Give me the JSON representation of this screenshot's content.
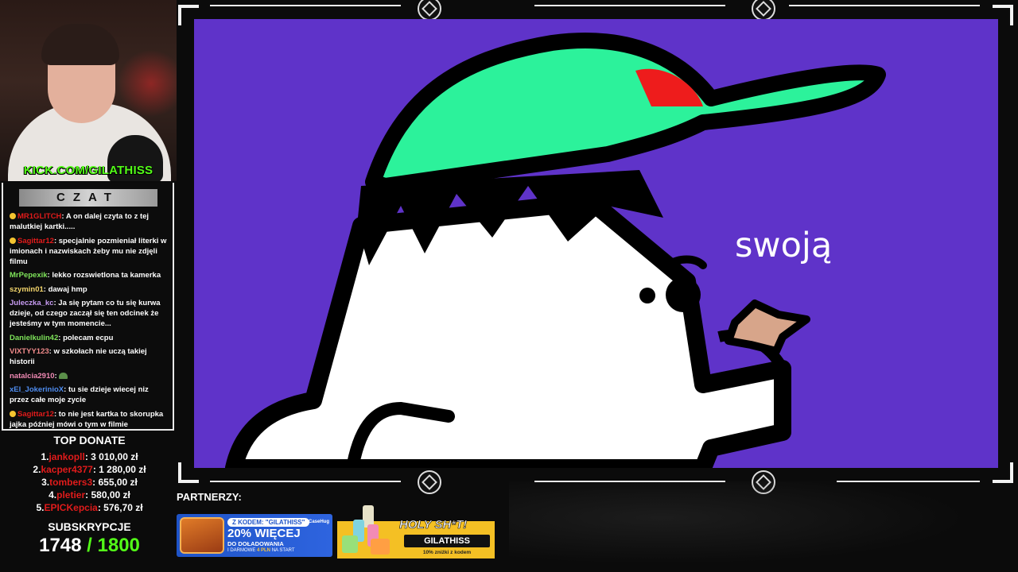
{
  "webcam": {
    "channel_url": "KICK.COM/GILATHISS"
  },
  "chat": {
    "title": "CZAT",
    "messages": [
      {
        "user": "MR1GLITCH",
        "color": "#e01b1b",
        "badge": true,
        "text": "A on dalej czyta to z tej malutkiej kartki....."
      },
      {
        "user": "Sagittar12",
        "color": "#e01b1b",
        "badge": true,
        "text": "specjalnie pozmieniał literki w imionach i nazwiskach żeby mu nie zdjęli filmu"
      },
      {
        "user": "MrPepexik",
        "color": "#7ee35a",
        "badge": false,
        "text": "lekko rozswietlona ta kamerka"
      },
      {
        "user": "szymin01",
        "color": "#f2d46b",
        "badge": false,
        "text": "dawaj hmp"
      },
      {
        "user": "Juleczka_kc",
        "color": "#c79bf2",
        "badge": false,
        "text": "Ja się pytam co tu się kurwa dzieje, od czego zaczął się ten odcinek że jesteśmy w tym momencie..."
      },
      {
        "user": "Danielkulin42",
        "color": "#7ee35a",
        "badge": false,
        "text": "polecam ecpu"
      },
      {
        "user": "VIXTYY123",
        "color": "#f08a8a",
        "badge": false,
        "text": "w szkołach nie uczą takiej historii"
      },
      {
        "user": "natalcia2910",
        "color": "#f08ab4",
        "badge": false,
        "text": "",
        "emote": true
      },
      {
        "user": "xEl_JokerinioX",
        "color": "#4f8df0",
        "badge": false,
        "text": "tu sie dzieje wiecej niz przez całe moje zycie"
      },
      {
        "user": "Sagittar12",
        "color": "#e01b1b",
        "badge": true,
        "text": "to nie jest kartka to skorupka jajka później mówi o tym w filmie"
      }
    ]
  },
  "top_donate": {
    "title": "TOP DONATE",
    "entries": [
      {
        "rank": "1.",
        "name": "jankopll",
        "amount": "3 010,00 zł"
      },
      {
        "rank": "2.",
        "name": "kacper4377",
        "amount": "1 280,00 zł"
      },
      {
        "rank": "3.",
        "name": "tombers3",
        "amount": "655,00 zł"
      },
      {
        "rank": "4.",
        "name": "pletier",
        "amount": "580,00 zł"
      },
      {
        "rank": "5.",
        "name": "EPICKepcia",
        "amount": "576,70 zł"
      }
    ]
  },
  "subs": {
    "title": "SUBSKRYPCJE",
    "current": "1748",
    "goal": "/ 1800"
  },
  "video": {
    "subtitle": "swoją"
  },
  "partners": {
    "label": "PARTNERZY:",
    "casehug": {
      "code_label": "Z KODEM: \"GILATHISS\"",
      "brand": "CaseHug",
      "headline": "20% WIĘCEJ",
      "line1": "DO DOŁADOWANIA",
      "line2_prefix": "I DARMOWE",
      "line2_highlight": "4 PLN",
      "line2_suffix": "NA START"
    },
    "holy": {
      "title": "HOLY SH*T!",
      "code": "GILATHISS",
      "promo": "10% zniżki z kodem"
    }
  },
  "colors": {
    "video_bg": "#5f33c9",
    "cap": "#2cf29b",
    "cap_spot": "#ee1c1c",
    "kick_green": "#53fc18"
  }
}
